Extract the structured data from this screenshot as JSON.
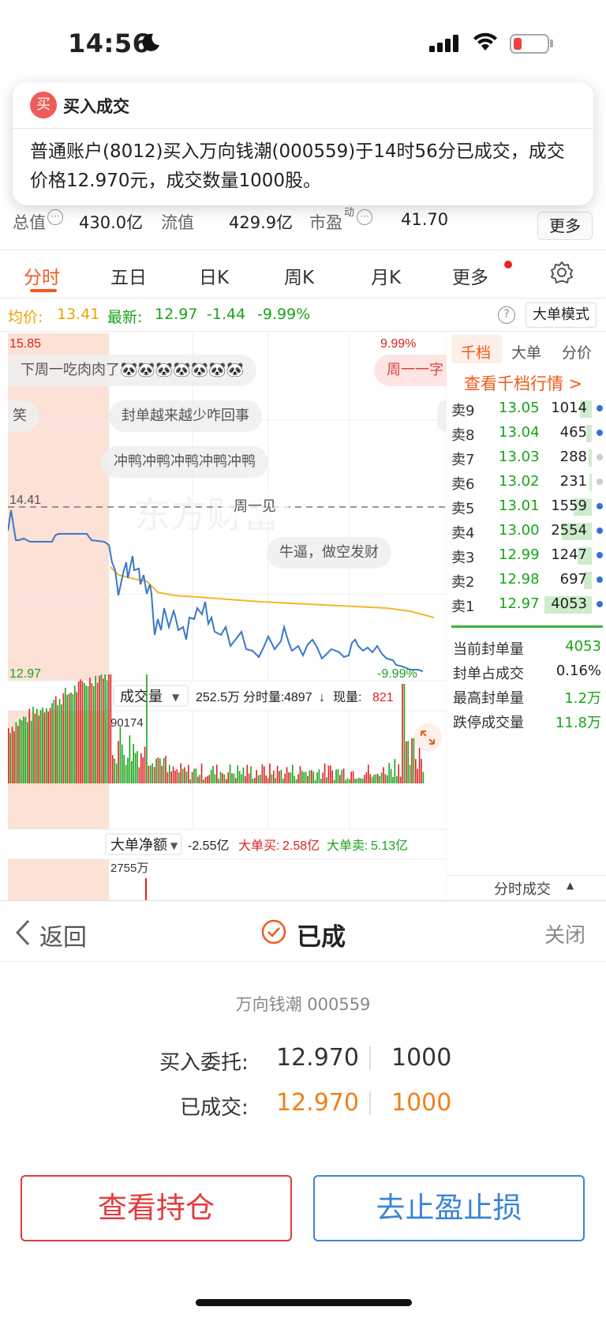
{
  "status_bar": {
    "time": "14:56"
  },
  "notification": {
    "badge": "买",
    "title": "买入成交",
    "body": "普通账户(8012)买入万向钱潮(000559)于14时56分已成交，成交价格12.970元，成交数量1000股。"
  },
  "metrics": {
    "total_value_label": "总值",
    "total_value": "430.0亿",
    "float_value_label": "流值",
    "float_value": "429.9亿",
    "pe_label": "市盈",
    "pe_sup": "动",
    "pe_value": "41.70",
    "more_button": "更多"
  },
  "tabs": [
    "分时",
    "五日",
    "日K",
    "周K",
    "月K",
    "更多"
  ],
  "price_info": {
    "avg_label": "均价:",
    "avg_value": "13.41",
    "latest_label": "最新:",
    "latest_value": "12.97",
    "change": "-1.44",
    "change_pct": "-9.99%",
    "help_icon": "?",
    "big_order_mode": "大单模式"
  },
  "chart": {
    "high_price": "15.85",
    "high_pct": "9.99%",
    "mid_price": "14.41",
    "low_price": "12.97",
    "low_pct": "-9.99%",
    "volume_selector": "成交量",
    "volume_total": "252.5万",
    "period_vol_label": "分时量:",
    "period_vol_value": "4897",
    "current_vol_label": "现量:",
    "current_vol_value": "821",
    "vol_peak": "90174",
    "net_selector": "大单净额",
    "net_value": "-2.55亿",
    "big_buy_label": "大单买:",
    "big_buy_value": "2.58亿",
    "big_sell_label": "大单卖:",
    "big_sell_value": "5.13亿",
    "net_peak": "2755万",
    "watermark": "东方财富",
    "comments": [
      "下周一吃肉肉了🐼🐼🐼🐼🐼🐼🐼",
      "周一一字",
      "笑",
      "封单越来越少咋回事",
      "冲鸭冲鸭冲鸭冲鸭冲鸭",
      "周一见",
      "牛逼，做空发财"
    ]
  },
  "order_book": {
    "tabs": [
      "千档",
      "大单",
      "分价"
    ],
    "view_link": "查看千档行情 >",
    "rows": [
      {
        "label": "卖9",
        "price": "13.05",
        "volume": "1014"
      },
      {
        "label": "卖8",
        "price": "13.04",
        "volume": "465"
      },
      {
        "label": "卖7",
        "price": "13.03",
        "volume": "288"
      },
      {
        "label": "卖6",
        "price": "13.02",
        "volume": "231"
      },
      {
        "label": "卖5",
        "price": "13.01",
        "volume": "1559"
      },
      {
        "label": "卖4",
        "price": "13.00",
        "volume": "2554"
      },
      {
        "label": "卖3",
        "price": "12.99",
        "volume": "1247"
      },
      {
        "label": "卖2",
        "price": "12.98",
        "volume": "697"
      },
      {
        "label": "卖1",
        "price": "12.97",
        "volume": "4053"
      }
    ],
    "stats": [
      {
        "label": "当前封单量",
        "value": "4053"
      },
      {
        "label": "封单占成交",
        "value": "0.16%"
      },
      {
        "label": "最高封单量",
        "value": "1.2万"
      },
      {
        "label": "跌停成交量",
        "value": "11.8万"
      }
    ],
    "trade_toggle": "分时成交"
  },
  "sheet": {
    "back": "返回",
    "status": "已成",
    "close": "关闭",
    "stock": "万向钱潮 000559",
    "entrust_label": "买入委托:",
    "entrust_price": "12.970",
    "entrust_qty": "1000",
    "filled_label": "已成交:",
    "filled_price": "12.970",
    "filled_qty": "1000",
    "btn_position": "查看持仓",
    "btn_stop": "去止盈止损"
  },
  "colors": {
    "accent": "#f05a1a",
    "up": "#e02020",
    "down": "#1aa31a",
    "price_line": "#3b78c8",
    "avg_line": "#f5b62a"
  }
}
